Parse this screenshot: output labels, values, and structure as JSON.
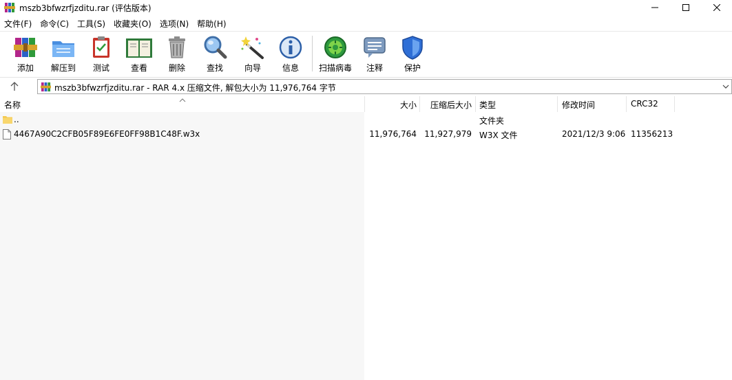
{
  "window": {
    "title": "mszb3bfwzrfjzditu.rar (评估版本)"
  },
  "menu": [
    {
      "label": "文件(F)"
    },
    {
      "label": "命令(C)"
    },
    {
      "label": "工具(S)"
    },
    {
      "label": "收藏夹(O)"
    },
    {
      "label": "选项(N)"
    },
    {
      "label": "帮助(H)"
    }
  ],
  "toolbar": {
    "add": "添加",
    "extract": "解压到",
    "test": "测试",
    "view": "查看",
    "delete": "删除",
    "find": "查找",
    "wizard": "向导",
    "info": "信息",
    "scan": "扫描病毒",
    "comment": "注释",
    "protect": "保护"
  },
  "address": {
    "text": "mszb3bfwzrfjzditu.rar - RAR 4.x 压缩文件, 解包大小为 11,976,764 字节"
  },
  "columns": {
    "name": "名称",
    "size": "大小",
    "packed": "压缩后大小",
    "type": "类型",
    "modified": "修改时间",
    "crc": "CRC32"
  },
  "rows": [
    {
      "name": "..",
      "size": "",
      "packed": "",
      "type": "文件夹",
      "modified": "",
      "crc": ""
    },
    {
      "name": "4467A90C2CFB05F89E6FE0FF98B1C48F.w3x",
      "size": "11,976,764",
      "packed": "11,927,979",
      "type": "W3X 文件",
      "modified": "2021/12/3 9:06",
      "crc": "11356213"
    }
  ],
  "colors": {
    "folder": "#f4c94e",
    "window_bg": "#ffffff",
    "name_pane": "#f7f7f7"
  }
}
